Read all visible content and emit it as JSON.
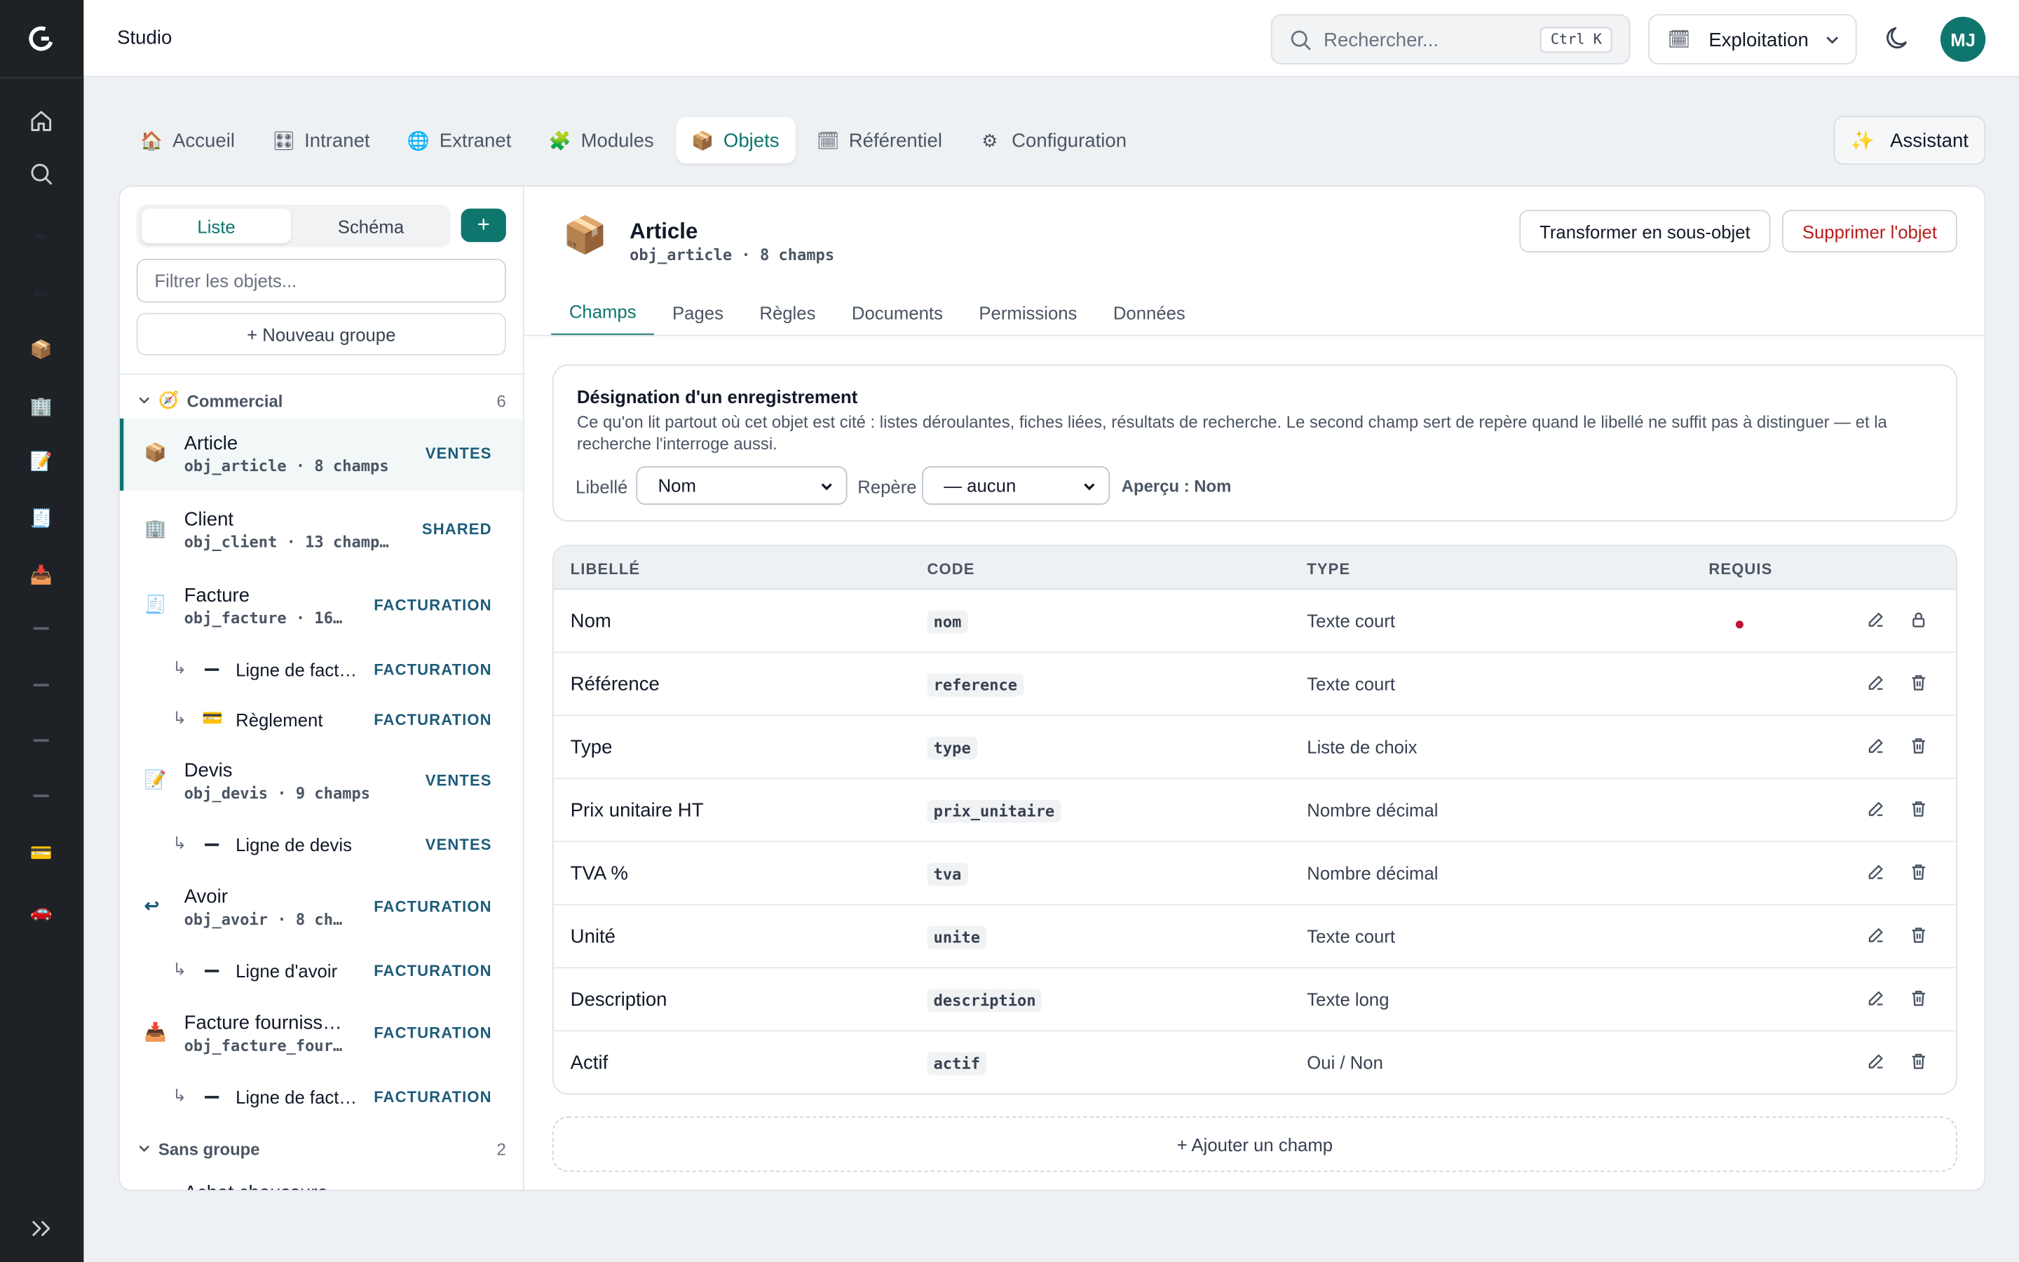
{
  "app": {
    "title": "Studio",
    "avatar_initials": "MJ",
    "accent": "#0f766e"
  },
  "search": {
    "placeholder": "Rechercher...",
    "shortcut": "Ctrl K"
  },
  "environment": {
    "label": "Exploitation",
    "icon": "calendar-icon"
  },
  "tabs": [
    {
      "label": "Accueil",
      "icon": "🏠"
    },
    {
      "label": "Intranet",
      "icon": "🎛"
    },
    {
      "label": "Extranet",
      "icon": "🌐"
    },
    {
      "label": "Modules",
      "icon": "🧩"
    },
    {
      "label": "Objets",
      "icon": "📦"
    },
    {
      "label": "Référentiel",
      "icon": "🗓"
    },
    {
      "label": "Configuration",
      "icon": "⚙"
    }
  ],
  "assistant": {
    "label": "Assistant",
    "icon": "✨"
  },
  "sidebar": {
    "view_list": "Liste",
    "view_schema": "Schéma",
    "add": "+",
    "filter_placeholder": "Filtrer les objets...",
    "new_group": "+ Nouveau groupe",
    "groups": [
      {
        "name": "Commercial",
        "count": "6",
        "icon": "🧭"
      },
      {
        "name": "Sans groupe",
        "count": "2"
      }
    ],
    "items": [
      {
        "name": "Article",
        "code": "obj_article · 8 champs",
        "badge": "VENTES",
        "icon": "📦"
      },
      {
        "name": "Client",
        "code": "obj_client · 13 champ…",
        "badge": "SHARED",
        "icon": "🏢"
      },
      {
        "name": "Facture",
        "code": "obj_facture · 16…",
        "badge": "FACTURATION",
        "icon": "🧾"
      },
      {
        "name": "Ligne de fact…",
        "badge": "FACTURATION"
      },
      {
        "name": "Règlement",
        "badge": "FACTURATION",
        "icon": "💳"
      },
      {
        "name": "Devis",
        "code": "obj_devis · 9 champs",
        "badge": "VENTES",
        "icon": "📝"
      },
      {
        "name": "Ligne de devis",
        "badge": "VENTES"
      },
      {
        "name": "Avoir",
        "code": "obj_avoir · 8 ch…",
        "badge": "FACTURATION",
        "icon": "↩"
      },
      {
        "name": "Ligne d'avoir",
        "badge": "FACTURATION"
      },
      {
        "name": "Facture fourniss…",
        "code": "obj_facture_four…",
        "badge": "FACTURATION",
        "icon": "📥"
      },
      {
        "name": "Ligne de fact…",
        "badge": "FACTURATION"
      },
      {
        "name": "Achat chaussure"
      }
    ],
    "sub_arrow": "↳"
  },
  "object": {
    "icon": "📦",
    "title": "Article",
    "subtitle": "obj_article · 8 champs",
    "convert_label": "Transformer en sous-objet",
    "delete_label": "Supprimer l'objet"
  },
  "subtabs": [
    "Champs",
    "Pages",
    "Règles",
    "Documents",
    "Permissions",
    "Données"
  ],
  "designation": {
    "title": "Désignation d'un enregistrement",
    "description": "Ce qu'on lit partout où cet objet est cité : listes déroulantes, fiches liées, résultats de recherche. Le second champ sert de repère quand le libellé ne suffit pas à distinguer — et la recherche l'interroge aussi.",
    "label_libelle": "Libellé",
    "libelle_value": "Nom",
    "label_repere": "Repère",
    "repere_value": "— aucun",
    "apercu": "Aperçu : Nom"
  },
  "table": {
    "headers": [
      "LIBELLÉ",
      "CODE",
      "TYPE",
      "REQUIS"
    ],
    "rows": [
      {
        "label": "Nom",
        "code": "nom",
        "type": "Texte court",
        "required": true,
        "locked": true
      },
      {
        "label": "Référence",
        "code": "reference",
        "type": "Texte court"
      },
      {
        "label": "Type",
        "code": "type",
        "type": "Liste de choix"
      },
      {
        "label": "Prix unitaire HT",
        "code": "prix_unitaire",
        "type": "Nombre décimal"
      },
      {
        "label": "TVA %",
        "code": "tva",
        "type": "Nombre décimal"
      },
      {
        "label": "Unité",
        "code": "unite",
        "type": "Texte court"
      },
      {
        "label": "Description",
        "code": "description",
        "type": "Texte long"
      },
      {
        "label": "Actif",
        "code": "actif",
        "type": "Oui / Non"
      }
    ]
  },
  "add_field": "+ Ajouter un champ",
  "rail_icons": [
    "home-icon",
    "search-icon",
    "pen-icon",
    "return-icon",
    "package-icon",
    "building-icon",
    "memo-icon",
    "receipt-icon",
    "inbox-icon",
    "card-icon",
    "car-icon",
    "expand-icon"
  ]
}
